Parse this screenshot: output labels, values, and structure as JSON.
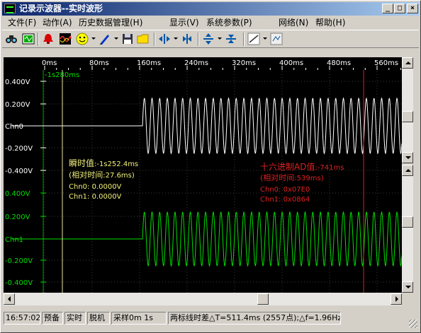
{
  "window": {
    "title": "记录示波器--实时波形",
    "buttons": {
      "minimize": "_",
      "maximize": "□",
      "close": "×"
    }
  },
  "menu": [
    {
      "label": "文件(F)"
    },
    {
      "label": "动作(A)"
    },
    {
      "label": "历史数据管理(H)"
    },
    {
      "label": "显示(V)"
    },
    {
      "label": "系统参数(P)"
    },
    {
      "label": "网络(N)"
    },
    {
      "label": "帮助(H)"
    }
  ],
  "toolbar_icons": [
    "binoculars-icon",
    "channel-panel-icon",
    "bell-icon",
    "waveform-icon",
    "smiley-icon",
    "pen-icon",
    "save-disk-icon",
    "folder-icon",
    "zoom-in-horizontal-icon",
    "zoom-out-horizontal-icon",
    "zoom-in-vertical-icon",
    "zoom-out-vertical-icon",
    "cursor-mode-icon",
    "settings-icon"
  ],
  "x_axis": {
    "tick_labels": [
      "0ms",
      "80ms",
      "160ms",
      "240ms",
      "320ms",
      "400ms",
      "480ms",
      "560ms"
    ],
    "offset_label": "-1s280ms"
  },
  "channels": [
    {
      "name": "Chn0",
      "color": "#ffffff",
      "y_labels": [
        "0.400V",
        "0.200V",
        "-0.200V",
        "-0.400V"
      ]
    },
    {
      "name": "Chn1",
      "color": "#00dd00",
      "y_labels": [
        "0.400V",
        "0.200V",
        "-0.200V",
        "-0.400V"
      ]
    }
  ],
  "cursor_a": {
    "color": "#f0f07c",
    "line_color": "#e8e8a8",
    "title_prefix": "瞬时值",
    "title_value": ":-1s252.4ms",
    "relative_prefix": "(相对时间",
    "relative_value": ":27.6ms)",
    "chn0": "Chn0: 0.0000V",
    "chn1": "Chn1: 0.0000V"
  },
  "cursor_b": {
    "color": "#e02020",
    "title_prefix": "十六进制AD值",
    "title_value": ":-741ms",
    "relative_prefix": "(相对时间",
    "relative_value": ":539ms)",
    "chn0": "Chn0: 0x07E0",
    "chn1": "Chn1: 0x0864"
  },
  "status": {
    "time": "16:57:02",
    "mode1": "预备",
    "mode2": "实时",
    "mode3": "脱机",
    "sample": "采样0m 1s",
    "delta": "两标线时差△T=511.4ms (2557点);△f=1.96Hz"
  }
}
